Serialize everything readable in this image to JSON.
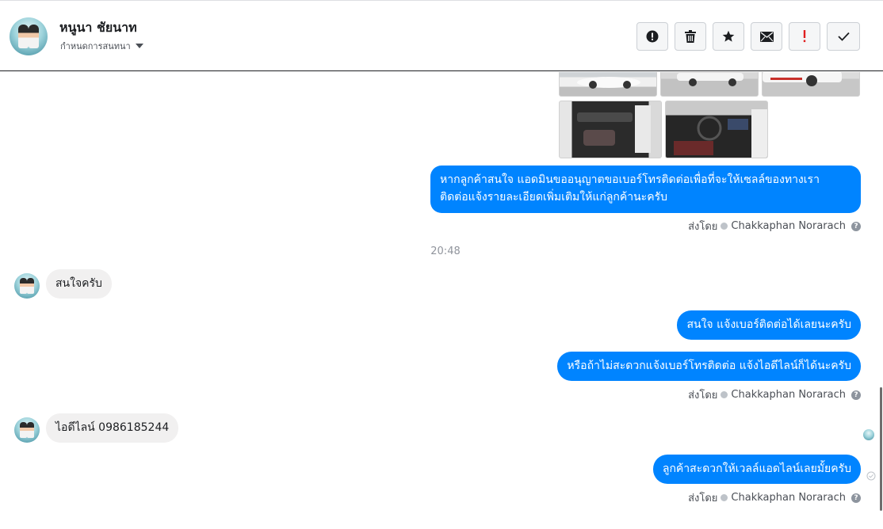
{
  "header": {
    "contact_name": "หนูนา ชัยนาท",
    "assign_label": "กำหนดการสนทนา",
    "actions": [
      {
        "name": "report-button",
        "icon": "exclamation-circle-icon"
      },
      {
        "name": "delete-button",
        "icon": "trash-icon"
      },
      {
        "name": "star-button",
        "icon": "star-icon"
      },
      {
        "name": "mark-unread-button",
        "icon": "envelope-icon"
      },
      {
        "name": "follow-up-button",
        "icon": "red-exclamation-icon"
      },
      {
        "name": "mark-done-button",
        "icon": "checkmark-icon"
      }
    ]
  },
  "messages": {
    "m1": "หากลูกค้าสนใจ แอดมินขออนุญาตขอเบอร์โทรติดต่อเพื่อที่จะให้เซลล์ของทางเรา",
    "m1b": "ติดต่อแจ้งรายละเอียดเพิ่มเติมให้แก่ลูกค้านะครับ",
    "time1": "20:48",
    "c1": "สนใจครับ",
    "m2": "สนใจ แจ้งเบอร์ติดต่อได้เลยนะครับ",
    "m3": "หรือถ้าไม่สะดวกแจ้งเบอร์โทรติดต่อ แจ้งไอดีไลน์ก็ได้นะครับ",
    "c2": "ไอดีไลน์ 0986185244",
    "m4": "ลูกค้าสะดวกให้เวลล์แอดไลน์เลยมั้ยครับ"
  },
  "sent_by": {
    "prefix": "ส่งโดย",
    "agent": "Chakkaphan Norarach",
    "help": "?"
  },
  "colors": {
    "outgoing_bubble": "#0084ff",
    "incoming_bubble": "#f1f0f0",
    "follow_up_accent": "#e02020"
  }
}
